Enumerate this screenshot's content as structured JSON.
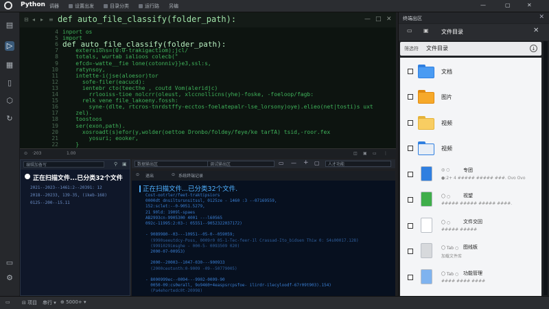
{
  "app": {
    "name": "Python"
  },
  "menu": [
    "调器",
    "设置出发",
    "目录分类",
    "运行路",
    "另编"
  ],
  "right_header": {
    "title": "终端出区"
  },
  "editor": {
    "tab_title": "def auto_file_classify(folder_path):",
    "line_numbers": [
      "4",
      "5",
      "6",
      "7",
      "8",
      "9",
      "10",
      "11",
      "12",
      "13",
      "14",
      "15",
      "16",
      "17",
      "18",
      "19",
      "20",
      "21",
      "22"
    ],
    "code_lines": [
      "inport os",
      "import",
      "def auto_file_classify(folder_path):",
      "    extersions=(0:0-trakigactiom);jcl/",
      "    totals, wurtab ialioos colecb(\"",
      "    efcd=-watte__fie lone(cotonniv}}e3,ssl:s,",
      "    ratynsoy,",
      "    intette-i(jse(aloesor)tor",
      "      sofe-filer(eacucd):",
      "      ientebr cto(teecthe , coutd Vom(aleridjc)",
      "        rrlooiss-tioe nolcrr(oleust, xlccnollicns(yhe)-foske, -foeloop/fagb:",
      "      relk vene file_lakoeny.fossh:",
      "        syne-(dlte, rtcros-tnrdstffy-ecctos-foelatepalr-lse_lorsony)oye).elieo(net|tosti)s uxt",
      "    zel).",
      "    toostoos",
      "    ser(exon,path).",
      "      xosroadt(s)efor(y,wolder(oettoe Dronbo/foldey/feye/ke tarTA) tsid,-roor.fex",
      "        yosuri; eooker,",
      "    }"
    ],
    "right_icons": [
      "—",
      "□",
      "✕"
    ]
  },
  "splitbar": {
    "left": "·203",
    "mid": "1.00",
    "right_icons": [
      "◫",
      "▣",
      "▭",
      "⋮"
    ]
  },
  "left_pane": {
    "search_placeholder": "编辑加备写",
    "title": "正在扫描文件...已分类32个文件",
    "lines": [
      "2021--2023--1461:2--20391: 12",
      "2018--20233, 139-35, (ikeb-168)",
      "0125--200--15.11"
    ]
  },
  "mid_header": {
    "field1": "数据输出区",
    "field2": "调试输出区",
    "field3": "人才功能"
  },
  "terminal": {
    "tabs": [
      "退出",
      "系统终端记录"
    ],
    "head": "正在扫描文件...已分类32个文件.",
    "lines": [
      "Cost-ootrler/feet-traktipsiors",
      "0000dt dnsiltsrsnsitssl, 0125ze - 1460 :3 --07169559,",
      "152:sclet:--0-9051.5279,",
      "21 90ld: 1909l-spaes",
      "AB2993cn-9905300 4001 ---l60565",
      "092c-11995:2:03-: 05551--9052322037172)",
      "",
      "- 9089980--03---10951--05-0--059059;",
      "  (9990seeutdcy-Poss, 0009r0 05-1-Tec-feer-1l Crassad-Ito_bidsen Thiw 0: S4s00017.128)",
      "  (9991029imsghe - 000-5- 0093509 020)",
      "  2000-07-00953)",
      "",
      "  2000--20003--1047-030---900933",
      "  (2000ceotonth:0-9009 -09--50779005)",
      "",
      "- 8000999ec--0094---9902-0009-90",
      "  0050-09:cs0erall, 9o9460+4easpsrcpsfoe- ilirdr-ilecyloodf-67r09t903).154)",
      "  (Pa4ehortedc0t-20998)"
    ]
  },
  "file_panel": {
    "title": "文件目录",
    "search_mode": "筛选符",
    "search_label": "文件目录",
    "items": [
      {
        "label": "文档",
        "kind": "folder-blue"
      },
      {
        "label": "图片",
        "kind": "folder-orange"
      },
      {
        "label": "视频",
        "kind": "folder-yellow"
      },
      {
        "label": "视频",
        "kind": "folder-white"
      },
      {
        "label": "专团",
        "prefix": "◎ ○",
        "kind": "file-blue",
        "sub": "●:2+ 4 ##### ##### ###. Ovo Ovo"
      },
      {
        "label": "视望",
        "prefix": "〇 ○",
        "kind": "file-green",
        "sub": "##### ##### ##### ####."
      },
      {
        "label": "文件交回",
        "prefix": "〇 ○",
        "kind": "file-white",
        "sub": "##### #####"
      },
      {
        "label": "图线板",
        "prefix": "〇 Tab ○",
        "kind": "file-gray",
        "sub": "加载文件库"
      },
      {
        "label": "功能管理",
        "prefix": "〇 Tab ○",
        "kind": "file-lightblue",
        "sub": "#### #### ####"
      }
    ]
  },
  "status": {
    "items": [
      "⊟ 项目",
      "串行 ▾",
      "⊕ 5000+ ▾"
    ]
  },
  "colors": {
    "accent": "#3fb25a",
    "terminal": "#3a7fd4",
    "folder_blue": "#3b8de8",
    "folder_orange": "#f0a020",
    "folder_yellow": "#f6c64a"
  }
}
